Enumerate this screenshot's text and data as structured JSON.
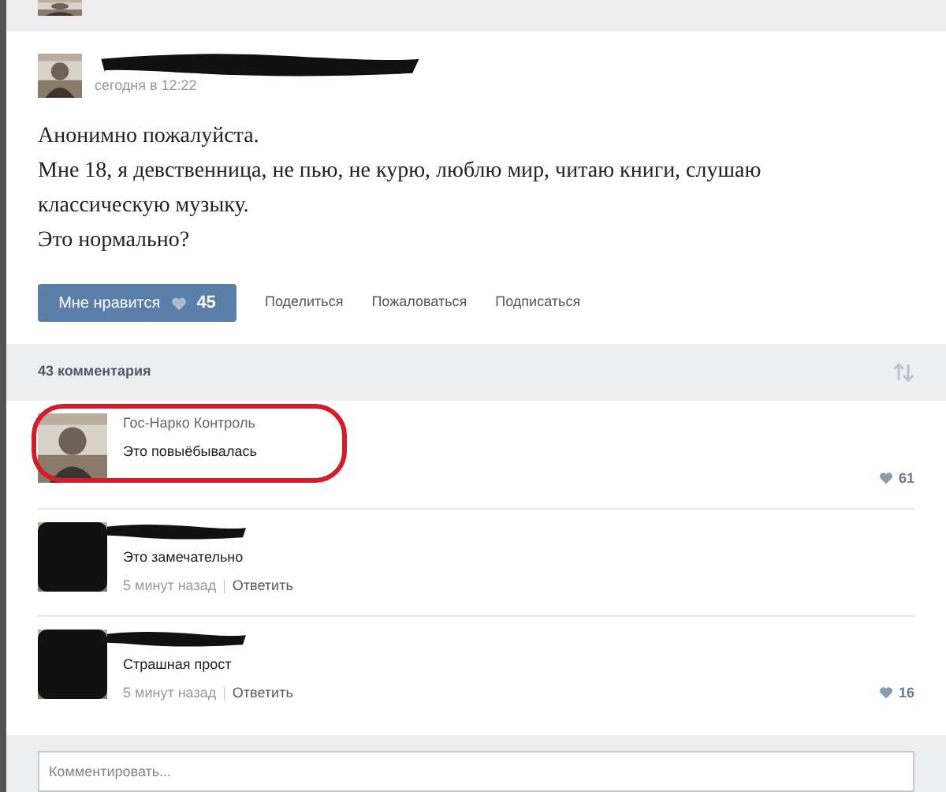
{
  "post": {
    "author_redacted": true,
    "time": "сегодня в 12:22",
    "lines": [
      "Анонимно пожалуйста.",
      "Мне 18, я девственница, не пью, не курю, люблю мир, читаю книги, слушаю классическую музыку.",
      "Это нормально?"
    ],
    "like_button": {
      "label": "Мне нравится",
      "count": "45"
    },
    "actions": [
      "Поделиться",
      "Пожаловаться",
      "Подписаться"
    ]
  },
  "comments_header": {
    "title": "43 комментария"
  },
  "comments": [
    {
      "author": "Гос-Нарко Контроль",
      "author_redacted": false,
      "text": "Это повыёбывалась",
      "likes": "61",
      "circled": true
    },
    {
      "author_redacted": true,
      "text": "Это замечательно",
      "time": "5 минут назад",
      "separator": "|",
      "reply": "Ответить",
      "circled": false
    },
    {
      "author_redacted": true,
      "text": "Страшная прост",
      "time": "5 минут назад",
      "separator": "|",
      "reply": "Ответить",
      "likes": "16",
      "circled": false
    }
  ],
  "comment_field": {
    "placeholder": "Комментировать..."
  }
}
